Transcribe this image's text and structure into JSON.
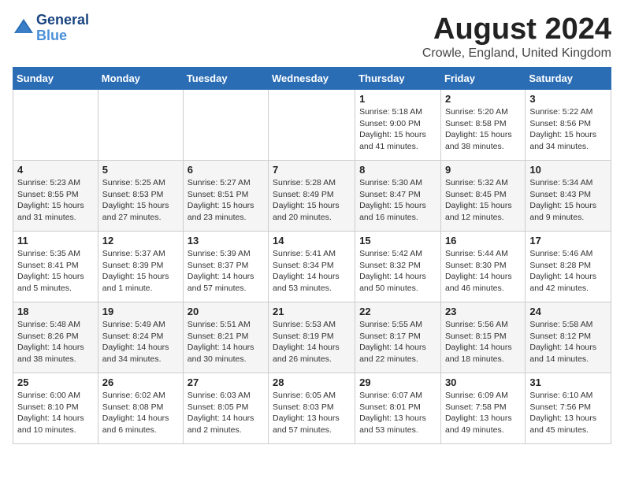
{
  "header": {
    "logo_line1": "General",
    "logo_line2": "Blue",
    "month_title": "August 2024",
    "subtitle": "Crowle, England, United Kingdom"
  },
  "weekdays": [
    "Sunday",
    "Monday",
    "Tuesday",
    "Wednesday",
    "Thursday",
    "Friday",
    "Saturday"
  ],
  "weeks": [
    [
      {
        "day": "",
        "sunrise": "",
        "sunset": "",
        "daylight": ""
      },
      {
        "day": "",
        "sunrise": "",
        "sunset": "",
        "daylight": ""
      },
      {
        "day": "",
        "sunrise": "",
        "sunset": "",
        "daylight": ""
      },
      {
        "day": "",
        "sunrise": "",
        "sunset": "",
        "daylight": ""
      },
      {
        "day": "1",
        "sunrise": "Sunrise: 5:18 AM",
        "sunset": "Sunset: 9:00 PM",
        "daylight": "Daylight: 15 hours and 41 minutes."
      },
      {
        "day": "2",
        "sunrise": "Sunrise: 5:20 AM",
        "sunset": "Sunset: 8:58 PM",
        "daylight": "Daylight: 15 hours and 38 minutes."
      },
      {
        "day": "3",
        "sunrise": "Sunrise: 5:22 AM",
        "sunset": "Sunset: 8:56 PM",
        "daylight": "Daylight: 15 hours and 34 minutes."
      }
    ],
    [
      {
        "day": "4",
        "sunrise": "Sunrise: 5:23 AM",
        "sunset": "Sunset: 8:55 PM",
        "daylight": "Daylight: 15 hours and 31 minutes."
      },
      {
        "day": "5",
        "sunrise": "Sunrise: 5:25 AM",
        "sunset": "Sunset: 8:53 PM",
        "daylight": "Daylight: 15 hours and 27 minutes."
      },
      {
        "day": "6",
        "sunrise": "Sunrise: 5:27 AM",
        "sunset": "Sunset: 8:51 PM",
        "daylight": "Daylight: 15 hours and 23 minutes."
      },
      {
        "day": "7",
        "sunrise": "Sunrise: 5:28 AM",
        "sunset": "Sunset: 8:49 PM",
        "daylight": "Daylight: 15 hours and 20 minutes."
      },
      {
        "day": "8",
        "sunrise": "Sunrise: 5:30 AM",
        "sunset": "Sunset: 8:47 PM",
        "daylight": "Daylight: 15 hours and 16 minutes."
      },
      {
        "day": "9",
        "sunrise": "Sunrise: 5:32 AM",
        "sunset": "Sunset: 8:45 PM",
        "daylight": "Daylight: 15 hours and 12 minutes."
      },
      {
        "day": "10",
        "sunrise": "Sunrise: 5:34 AM",
        "sunset": "Sunset: 8:43 PM",
        "daylight": "Daylight: 15 hours and 9 minutes."
      }
    ],
    [
      {
        "day": "11",
        "sunrise": "Sunrise: 5:35 AM",
        "sunset": "Sunset: 8:41 PM",
        "daylight": "Daylight: 15 hours and 5 minutes."
      },
      {
        "day": "12",
        "sunrise": "Sunrise: 5:37 AM",
        "sunset": "Sunset: 8:39 PM",
        "daylight": "Daylight: 15 hours and 1 minute."
      },
      {
        "day": "13",
        "sunrise": "Sunrise: 5:39 AM",
        "sunset": "Sunset: 8:37 PM",
        "daylight": "Daylight: 14 hours and 57 minutes."
      },
      {
        "day": "14",
        "sunrise": "Sunrise: 5:41 AM",
        "sunset": "Sunset: 8:34 PM",
        "daylight": "Daylight: 14 hours and 53 minutes."
      },
      {
        "day": "15",
        "sunrise": "Sunrise: 5:42 AM",
        "sunset": "Sunset: 8:32 PM",
        "daylight": "Daylight: 14 hours and 50 minutes."
      },
      {
        "day": "16",
        "sunrise": "Sunrise: 5:44 AM",
        "sunset": "Sunset: 8:30 PM",
        "daylight": "Daylight: 14 hours and 46 minutes."
      },
      {
        "day": "17",
        "sunrise": "Sunrise: 5:46 AM",
        "sunset": "Sunset: 8:28 PM",
        "daylight": "Daylight: 14 hours and 42 minutes."
      }
    ],
    [
      {
        "day": "18",
        "sunrise": "Sunrise: 5:48 AM",
        "sunset": "Sunset: 8:26 PM",
        "daylight": "Daylight: 14 hours and 38 minutes."
      },
      {
        "day": "19",
        "sunrise": "Sunrise: 5:49 AM",
        "sunset": "Sunset: 8:24 PM",
        "daylight": "Daylight: 14 hours and 34 minutes."
      },
      {
        "day": "20",
        "sunrise": "Sunrise: 5:51 AM",
        "sunset": "Sunset: 8:21 PM",
        "daylight": "Daylight: 14 hours and 30 minutes."
      },
      {
        "day": "21",
        "sunrise": "Sunrise: 5:53 AM",
        "sunset": "Sunset: 8:19 PM",
        "daylight": "Daylight: 14 hours and 26 minutes."
      },
      {
        "day": "22",
        "sunrise": "Sunrise: 5:55 AM",
        "sunset": "Sunset: 8:17 PM",
        "daylight": "Daylight: 14 hours and 22 minutes."
      },
      {
        "day": "23",
        "sunrise": "Sunrise: 5:56 AM",
        "sunset": "Sunset: 8:15 PM",
        "daylight": "Daylight: 14 hours and 18 minutes."
      },
      {
        "day": "24",
        "sunrise": "Sunrise: 5:58 AM",
        "sunset": "Sunset: 8:12 PM",
        "daylight": "Daylight: 14 hours and 14 minutes."
      }
    ],
    [
      {
        "day": "25",
        "sunrise": "Sunrise: 6:00 AM",
        "sunset": "Sunset: 8:10 PM",
        "daylight": "Daylight: 14 hours and 10 minutes."
      },
      {
        "day": "26",
        "sunrise": "Sunrise: 6:02 AM",
        "sunset": "Sunset: 8:08 PM",
        "daylight": "Daylight: 14 hours and 6 minutes."
      },
      {
        "day": "27",
        "sunrise": "Sunrise: 6:03 AM",
        "sunset": "Sunset: 8:05 PM",
        "daylight": "Daylight: 14 hours and 2 minutes."
      },
      {
        "day": "28",
        "sunrise": "Sunrise: 6:05 AM",
        "sunset": "Sunset: 8:03 PM",
        "daylight": "Daylight: 13 hours and 57 minutes."
      },
      {
        "day": "29",
        "sunrise": "Sunrise: 6:07 AM",
        "sunset": "Sunset: 8:01 PM",
        "daylight": "Daylight: 13 hours and 53 minutes."
      },
      {
        "day": "30",
        "sunrise": "Sunrise: 6:09 AM",
        "sunset": "Sunset: 7:58 PM",
        "daylight": "Daylight: 13 hours and 49 minutes."
      },
      {
        "day": "31",
        "sunrise": "Sunrise: 6:10 AM",
        "sunset": "Sunset: 7:56 PM",
        "daylight": "Daylight: 13 hours and 45 minutes."
      }
    ]
  ]
}
